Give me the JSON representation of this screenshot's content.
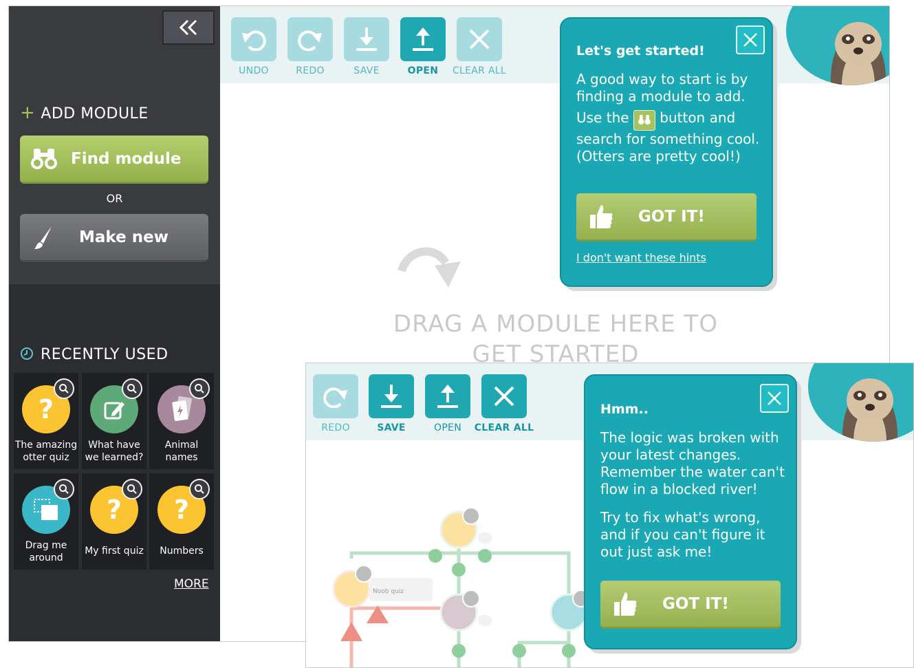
{
  "sidebar": {
    "collapse_label": "«",
    "add_module_title": "ADD MODULE",
    "find_module_label": "Find module",
    "or_label": "OR",
    "make_new_label": "Make new",
    "recently_used_title": "RECENTLY USED",
    "recent": [
      {
        "label": "The amazing otter quiz",
        "icon": "question-icon",
        "color": "#fcc430"
      },
      {
        "label": "What have we learned?",
        "icon": "edit-icon",
        "color": "#5daa78"
      },
      {
        "label": "Animal names",
        "icon": "cards-icon",
        "color": "#a8899b"
      },
      {
        "label": "Drag me around",
        "icon": "drag-icon",
        "color": "#3bb7c7"
      },
      {
        "label": "My first quiz",
        "icon": "question-icon",
        "color": "#fcc430"
      },
      {
        "label": "Numbers",
        "icon": "question-icon",
        "color": "#fcc430"
      }
    ],
    "more_label": "MORE"
  },
  "toolbar": {
    "undo": "UNDO",
    "redo": "REDO",
    "save": "SAVE",
    "open": "OPEN",
    "clear_all": "CLEAR ALL"
  },
  "canvas": {
    "drop_hint": "DRAG A MODULE HERE TO GET STARTED"
  },
  "hint1": {
    "title": "Let's get started!",
    "text1": "A good way to start is by finding a module to add.",
    "text2_before": "Use the",
    "text2_after": "button and search for something cool. (Otters are pretty cool!)",
    "got_it": "GOT IT!",
    "no_hints": "I don't want these hints"
  },
  "screen2": {
    "toolbar": {
      "redo": "REDO",
      "save": "SAVE",
      "open": "OPEN",
      "clear_all": "CLEAR ALL"
    },
    "node_label": "Noob quiz",
    "hint": {
      "title": "Hmm..",
      "text1": "The logic was broken with your latest changes. Remember the water can't flow in a blocked river!",
      "text2": "Try to fix what's wrong, and if you can't figure it out just ask me!",
      "got_it": "GOT IT!"
    }
  },
  "colors": {
    "accent": "#1aa9b4",
    "green": "#a2bc5c",
    "sidebar": "#3a3b3f"
  }
}
